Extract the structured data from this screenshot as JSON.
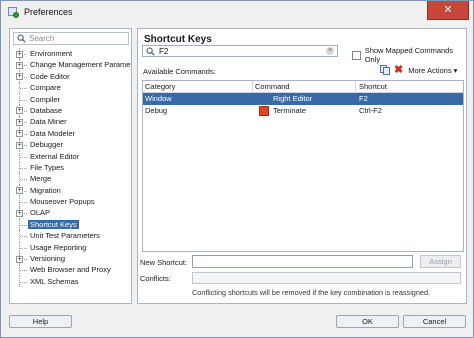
{
  "window": {
    "title": "Preferences",
    "close": "✕"
  },
  "left": {
    "search_placeholder": "Search",
    "tree": [
      {
        "label": "Environment",
        "expandable": true
      },
      {
        "label": "Change Management Paramet",
        "expandable": true
      },
      {
        "label": "Code Editor",
        "expandable": true
      },
      {
        "label": "Compare",
        "expandable": false
      },
      {
        "label": "Compiler",
        "expandable": false
      },
      {
        "label": "Database",
        "expandable": true
      },
      {
        "label": "Data Miner",
        "expandable": true
      },
      {
        "label": "Data Modeler",
        "expandable": true
      },
      {
        "label": "Debugger",
        "expandable": true
      },
      {
        "label": "External Editor",
        "expandable": false
      },
      {
        "label": "File Types",
        "expandable": false
      },
      {
        "label": "Merge",
        "expandable": false
      },
      {
        "label": "Migration",
        "expandable": true
      },
      {
        "label": "Mouseover Popups",
        "expandable": false
      },
      {
        "label": "OLAP",
        "expandable": true
      },
      {
        "label": "Shortcut Keys",
        "expandable": false,
        "selected": true
      },
      {
        "label": "Unit Test Parameters",
        "expandable": false
      },
      {
        "label": "Usage Reporting",
        "expandable": false
      },
      {
        "label": "Versioning",
        "expandable": true
      },
      {
        "label": "Web Browser and Proxy",
        "expandable": false
      },
      {
        "label": "XML Schemas",
        "expandable": false
      }
    ]
  },
  "right": {
    "title": "Shortcut Keys",
    "filter_value": "F2",
    "show_mapped_label": "Show Mapped Commands Only",
    "available_label": "Available Commands:",
    "more_actions": "More Actions ▾",
    "columns": [
      "Category",
      "Command",
      "Shortcut"
    ],
    "rows": [
      {
        "category": "Window",
        "command": "Right Editor",
        "shortcut": "F2",
        "icon": "blank",
        "selected": true
      },
      {
        "category": "Debug",
        "command": "Terminate",
        "shortcut": "Ctrl-F2",
        "icon": "stop",
        "selected": false
      }
    ],
    "new_shortcut_label": "New Shortcut:",
    "assign_label": "Assign",
    "conflicts_label": "Conflicts:",
    "note": "Conflicting shortcuts will be removed if the key combination is reassigned."
  },
  "buttons": {
    "help": "Help",
    "ok": "OK",
    "cancel": "Cancel"
  },
  "colors": {
    "selection": "#3a6aa6",
    "close": "#c7453a"
  }
}
